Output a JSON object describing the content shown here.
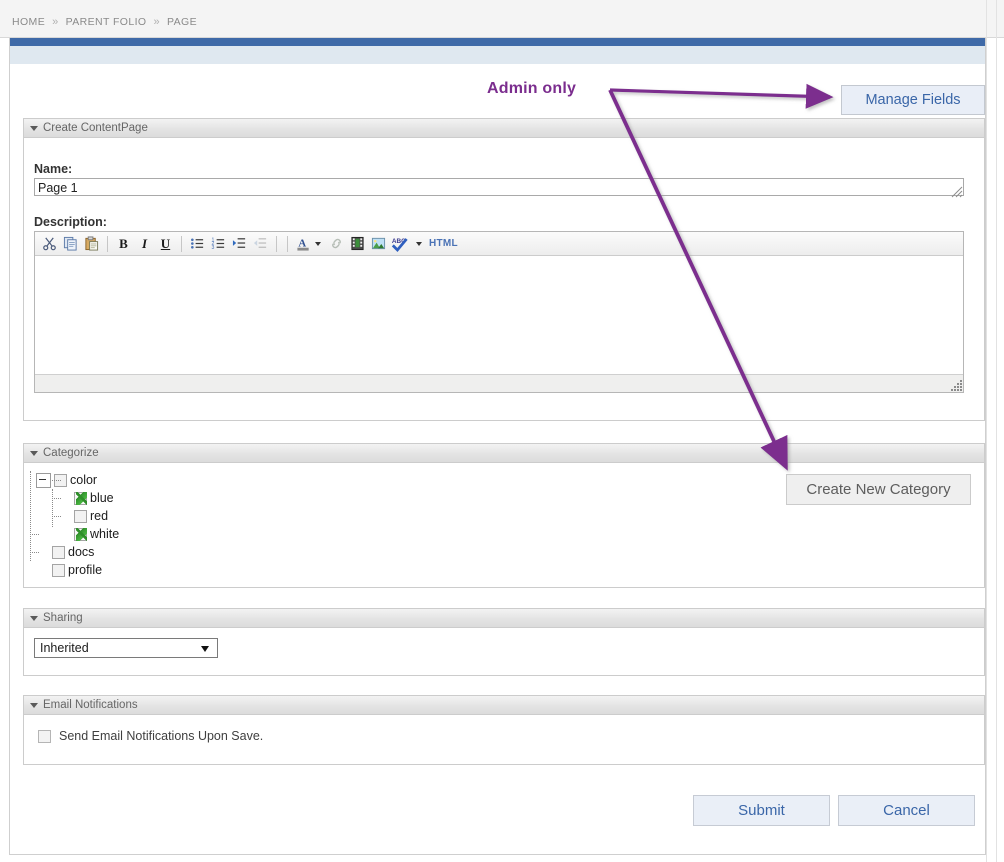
{
  "breadcrumb": {
    "items": [
      "HOME",
      "PARENT FOLIO",
      "PAGE"
    ],
    "separator": "»"
  },
  "annotation": {
    "label": "Admin only",
    "color": "#7b2d8e"
  },
  "toolbar": {
    "manage_fields_label": "Manage Fields"
  },
  "create_panel": {
    "title": "Create ContentPage",
    "name_label": "Name:",
    "name_value": "Page 1",
    "description_label": "Description:",
    "description_value": "",
    "editor_tools": [
      {
        "name": "cut-icon",
        "glyph": "✂",
        "title": "Cut"
      },
      {
        "name": "copy-icon",
        "glyph": "",
        "title": "Copy"
      },
      {
        "name": "paste-icon",
        "glyph": "",
        "title": "Paste"
      },
      {
        "name": "bold-icon",
        "glyph": "B",
        "title": "Bold"
      },
      {
        "name": "italic-icon",
        "glyph": "I",
        "title": "Italic"
      },
      {
        "name": "underline-icon",
        "glyph": "U",
        "title": "Underline"
      },
      {
        "name": "bullet-list-icon",
        "glyph": "",
        "title": "Bulleted list"
      },
      {
        "name": "numbered-list-icon",
        "glyph": "",
        "title": "Numbered list"
      },
      {
        "name": "indent-icon",
        "glyph": "",
        "title": "Increase indent"
      },
      {
        "name": "outdent-icon",
        "glyph": "",
        "title": "Decrease indent"
      },
      {
        "name": "text-color-icon",
        "glyph": "A",
        "title": "Text color"
      },
      {
        "name": "text-color-dropdown-icon",
        "glyph": "",
        "title": "Text color options"
      },
      {
        "name": "link-icon",
        "glyph": "",
        "title": "Insert link"
      },
      {
        "name": "media-icon",
        "glyph": "",
        "title": "Insert media"
      },
      {
        "name": "image-icon",
        "glyph": "",
        "title": "Insert image"
      },
      {
        "name": "spellcheck-icon",
        "glyph": "ABC",
        "title": "Spell check"
      },
      {
        "name": "spellcheck-dropdown-icon",
        "glyph": "",
        "title": "Spell check options"
      },
      {
        "name": "html-source-button",
        "glyph": "HTML",
        "title": "Edit HTML source"
      }
    ],
    "html_button_label": "HTML",
    "spellcheck_label": "ABC"
  },
  "categorize_panel": {
    "title": "Categorize",
    "create_button_label": "Create New Category",
    "tree": [
      {
        "label": "color",
        "level": 0,
        "checked": false,
        "expandable": true,
        "expanded": true
      },
      {
        "label": "blue",
        "level": 1,
        "checked": true,
        "expandable": false,
        "expanded": false
      },
      {
        "label": "red",
        "level": 1,
        "checked": false,
        "expandable": false,
        "expanded": false
      },
      {
        "label": "white",
        "level": 1,
        "checked": true,
        "expandable": false,
        "expanded": false
      },
      {
        "label": "docs",
        "level": 0,
        "checked": false,
        "expandable": false,
        "expanded": false
      },
      {
        "label": "profile",
        "level": 0,
        "checked": false,
        "expandable": false,
        "expanded": false
      }
    ]
  },
  "sharing_panel": {
    "title": "Sharing",
    "selected_option": "Inherited",
    "options": [
      "Inherited"
    ]
  },
  "email_panel": {
    "title": "Email Notifications",
    "checkbox_label": "Send Email Notifications Upon Save.",
    "checked": false
  },
  "actions": {
    "submit_label": "Submit",
    "cancel_label": "Cancel"
  }
}
